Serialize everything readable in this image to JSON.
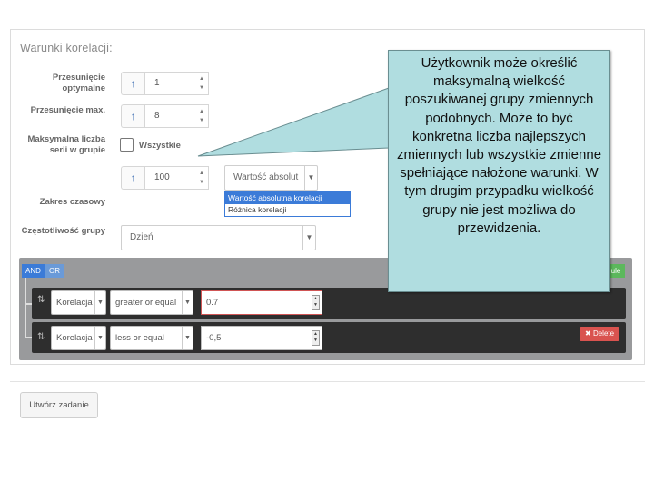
{
  "section": {
    "title": "Warunki korelacji:"
  },
  "fields": {
    "optimal_shift": {
      "label": "Przesunięcie optymalne",
      "value": "1"
    },
    "max_shift": {
      "label": "Przesunięcie max.",
      "value": "8"
    },
    "max_series": {
      "label": "Maksymalna liczba serii w grupie",
      "checkbox_label": "Wszystkie",
      "checked": false,
      "value": "100",
      "mode_selected": "Wartość absolut"
    },
    "time_range": {
      "label": "Zakres czasowy"
    },
    "frequency": {
      "label": "Częstotliwość grupy",
      "selected": "Dzień"
    }
  },
  "mode_dropdown": {
    "options": [
      "Wartość absolutna korelacji",
      "Różnica korelacji"
    ],
    "highlighted": 0
  },
  "query_builder": {
    "and_label": "AND",
    "or_label": "OR",
    "add_rule_fragment": "ule",
    "rules": [
      {
        "field": "Korelacja",
        "operator": "greater or equal",
        "value": "0.7"
      },
      {
        "field": "Korelacja",
        "operator": "less or equal",
        "value": "-0,5",
        "delete_label": "Delete"
      }
    ]
  },
  "submit": {
    "label": "Utwórz zadanie"
  },
  "callout": {
    "text": "Użytkownik może określić maksymalną wielkość poszukiwanej grupy zmiennych podobnych. Może to być konkretna liczba najlepszych zmiennych lub wszystkie zmienne spełniające nałożone warunki. W tym drugim przypadku wielkość grupy nie jest możliwa do przewidzenia."
  },
  "colors": {
    "accent": "#3b7bd8",
    "danger": "#d9534f",
    "success": "#5cb85c",
    "callout_bg": "#b0dde0"
  },
  "icons": {
    "shift": "arrow-up-icon",
    "drag": "sort-arrows-icon",
    "delete": "close-x-icon",
    "caret": "chevron-down-icon"
  }
}
